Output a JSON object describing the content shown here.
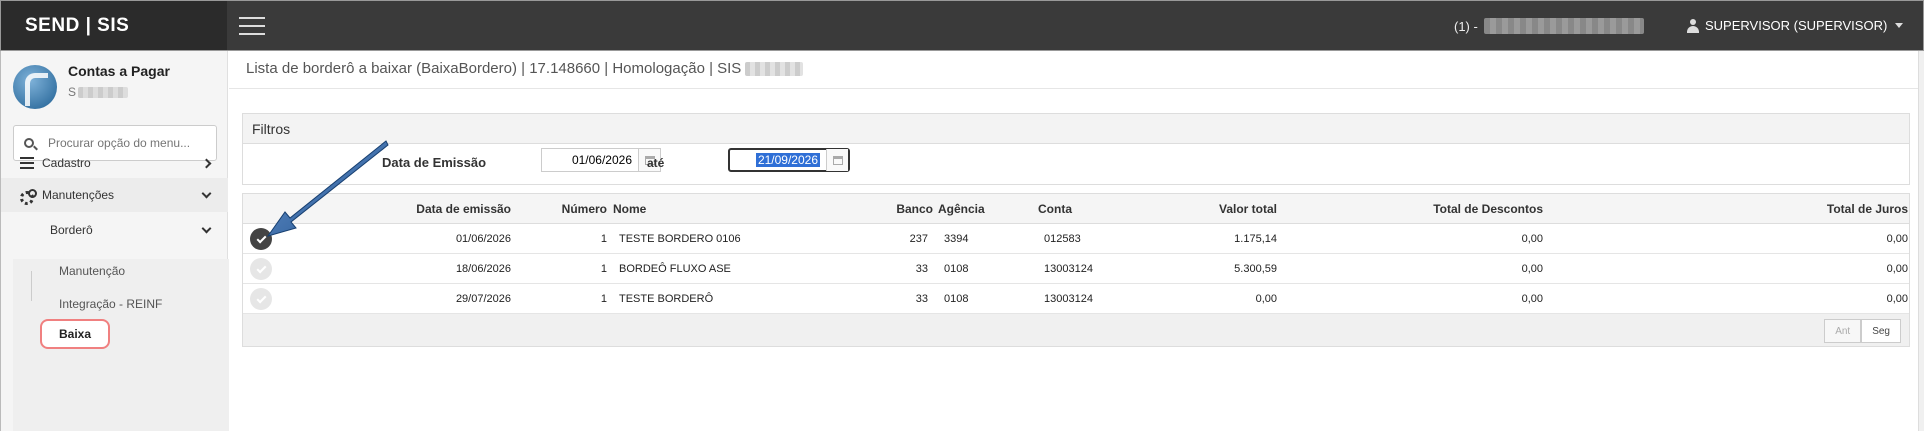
{
  "header": {
    "brand": "SEND | SIS",
    "env_prefix": "(1) -",
    "user": "SUPERVISOR (SUPERVISOR)"
  },
  "sidebar": {
    "module_title": "Contas a Pagar",
    "module_sub": "S",
    "search_placeholder": "Procurar opção do menu...",
    "items": [
      {
        "label": "Cadastro"
      },
      {
        "label": "Manutenções"
      },
      {
        "label": "Borderô"
      },
      {
        "label": "Manutenção"
      },
      {
        "label": "Integração - REINF"
      },
      {
        "label": "Baixa"
      }
    ]
  },
  "main": {
    "title": "Lista de borderô a baixar (BaixaBordero) | 17.148660 | Homologação | SIS",
    "filters": {
      "title": "Filtros",
      "date_label": "Data de Emissão",
      "date_from": "01/06/2026",
      "date_sep": "até",
      "date_to": "21/09/2026"
    },
    "table": {
      "columns": [
        "Data de emissão",
        "Número",
        "Nome",
        "Banco",
        "Agência",
        "Conta",
        "Valor total",
        "Total de Descontos",
        "Total de Juros"
      ],
      "rows": [
        {
          "selected": true,
          "data": "01/06/2026",
          "numero": "1",
          "nome": "TESTE BORDERO 0106",
          "banco": "237",
          "agencia": "3394",
          "conta": "012583",
          "valor": "1.175,14",
          "descontos": "0,00",
          "juros": "0,00"
        },
        {
          "selected": false,
          "data": "18/06/2026",
          "numero": "1",
          "nome": "BORDEÔ FLUXO ASE",
          "banco": "33",
          "agencia": "0108",
          "conta": "13003124",
          "valor": "5.300,59",
          "descontos": "0,00",
          "juros": "0,00"
        },
        {
          "selected": false,
          "data": "29/07/2026",
          "numero": "1",
          "nome": "TESTE BORDERÔ",
          "banco": "33",
          "agencia": "0108",
          "conta": "13003124",
          "valor": "0,00",
          "descontos": "0,00",
          "juros": "0,00"
        }
      ]
    },
    "pagination": {
      "prev": "Ant",
      "next": "Seg"
    }
  },
  "colors": {
    "topbar": "#3a3a3a",
    "brand_bg": "#2b2b2b",
    "annotation_arrow": "#1e4f8c",
    "highlight_ring": "#f08080",
    "selection": "#2f6fd6"
  }
}
